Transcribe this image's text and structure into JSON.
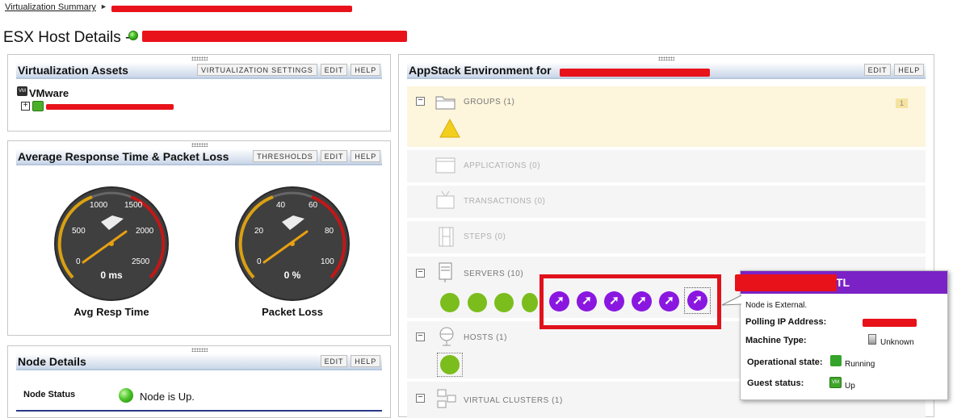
{
  "breadcrumb": {
    "link": "Virtualization Summary",
    "separator": "►"
  },
  "page": {
    "title": "ESX Host Details -"
  },
  "virtualization_assets": {
    "title": "Virtualization Assets",
    "buttons": [
      "VIRTUALIZATION SETTINGS",
      "EDIT",
      "HELP"
    ],
    "tree_root_icon": "VM",
    "tree_root": "VMware",
    "expander": "+"
  },
  "response_panel": {
    "title": "Average Response Time & Packet Loss",
    "buttons": [
      "THRESHOLDS",
      "EDIT",
      "HELP"
    ],
    "gauges": [
      {
        "label": "Avg Resp Time",
        "readout": "0 ms",
        "value": 0,
        "ticks": [
          "0",
          "500",
          "1000",
          "1500",
          "2000",
          "2500"
        ]
      },
      {
        "label": "Packet Loss",
        "readout": "0 %",
        "value": 0,
        "ticks": [
          "0",
          "20",
          "40",
          "60",
          "80",
          "100"
        ]
      }
    ]
  },
  "node_details": {
    "title": "Node Details",
    "buttons": [
      "EDIT",
      "HELP"
    ],
    "status_label": "Node Status",
    "status_value": "Node is Up."
  },
  "appstack": {
    "title": "AppStack Environment for",
    "buttons": [
      "EDIT",
      "HELP"
    ],
    "expander": "−",
    "categories": {
      "groups": {
        "label": "GROUPS (1)",
        "count": "1",
        "icon": "folder-icon"
      },
      "applications": {
        "label": "APPLICATIONS (0)",
        "icon": "application-window-icon"
      },
      "transactions": {
        "label": "TRANSACTIONS (0)",
        "icon": "tv-icon"
      },
      "steps": {
        "label": "STEPS (0)",
        "icon": "film-strip-icon"
      },
      "servers": {
        "label": "SERVERS (10)",
        "icon": "server-icon"
      },
      "hosts": {
        "label": "HOSTS (1)",
        "icon": "globe-stand-icon"
      },
      "clusters": {
        "label": "VIRTUAL CLUSTERS (1)",
        "icon": "cluster-icon"
      }
    },
    "external_node_glyph": "➚"
  },
  "tooltip": {
    "title_suffix": "TL",
    "line1": "Node is External.",
    "polling_label": "Polling IP Address:",
    "machine_label": "Machine Type:",
    "machine_value": "Unknown",
    "op_label": "Operational state:",
    "op_value": "Running",
    "guest_label": "Guest status:",
    "guest_value": "Up",
    "guest_icon_text": "VM"
  },
  "colors": {
    "redaction": "#e8121b",
    "header_gradient_end": "#c9d6e8",
    "external_node": "#8a17e0",
    "node_up": "#7bbd1c",
    "tooltip_header": "#7b22c6",
    "highlight_box": "#e0121b",
    "groups_row_bg": "#fdf5dc"
  }
}
